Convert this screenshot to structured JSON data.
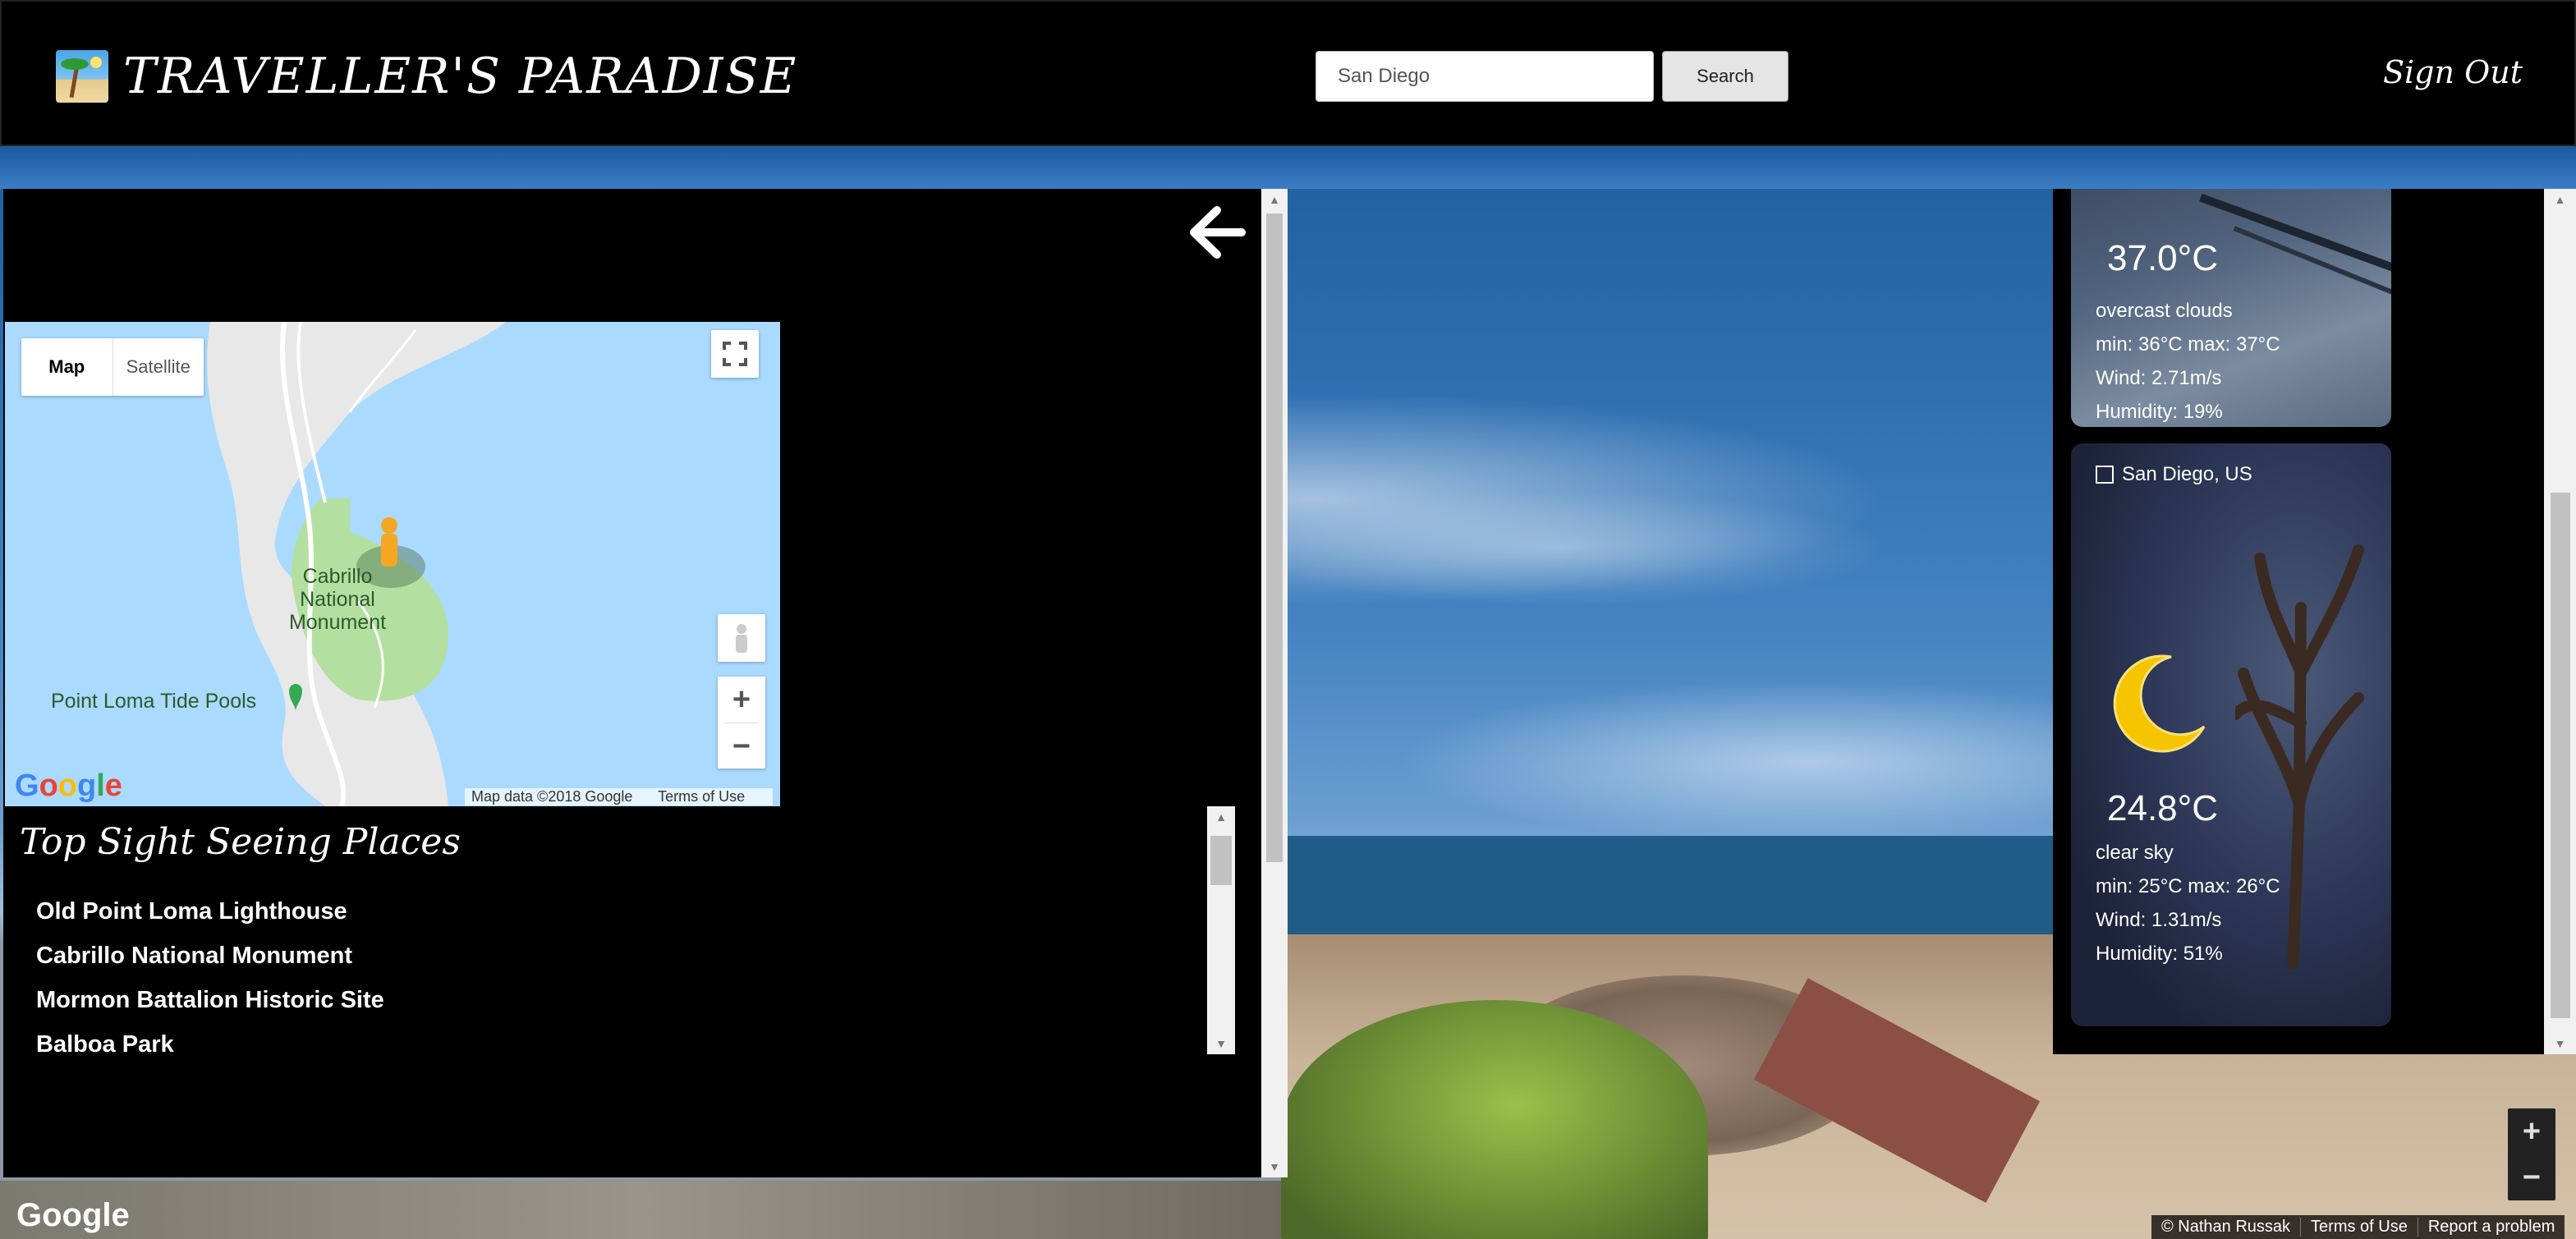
{
  "header": {
    "brand_title": "TRAVELLER'S PARADISE",
    "search_value": "San Diego",
    "search_button": "Search",
    "sign_out": "Sign Out"
  },
  "map": {
    "type_map": "Map",
    "type_satellite": "Satellite",
    "label_monument": "Cabrillo National Monument",
    "label_monument_lines": [
      "Cabrillo",
      "National",
      "Monument"
    ],
    "label_tide_pools": "Point Loma Tide Pools",
    "google_logo": "Google",
    "map_data": "Map data ©2018 Google",
    "terms": "Terms of Use",
    "zoom_in": "+",
    "zoom_out": "−"
  },
  "sights": {
    "title": "Top Sight Seeing Places",
    "items": [
      "Old Point Loma Lighthouse",
      "Cabrillo National Monument",
      "Mormon Battalion Historic Site",
      "Balboa Park"
    ]
  },
  "weather": {
    "cards": [
      {
        "temp": "37.0°C",
        "description": "overcast clouds",
        "minmax": "min: 36°C max: 37°C",
        "wind": "Wind: 2.71m/s",
        "humidity": "Humidity: 19%"
      },
      {
        "location": "San Diego, US",
        "checked": false,
        "icon": "moon-icon",
        "temp": "24.8°C",
        "description": "clear sky",
        "minmax": "min: 25°C max: 26°C",
        "wind": "Wind: 1.31m/s",
        "humidity": "Humidity: 51%"
      }
    ]
  },
  "streetview": {
    "google_logo": "Google",
    "zoom_in": "+",
    "zoom_out": "−",
    "footer": [
      "© Nathan Russak",
      "Terms of Use",
      "Report a problem"
    ]
  },
  "colors": {
    "header_bg": "#000000",
    "map_water": "#aadaff",
    "map_park": "#b3e0a1",
    "map_land": "#e8e8e8"
  }
}
